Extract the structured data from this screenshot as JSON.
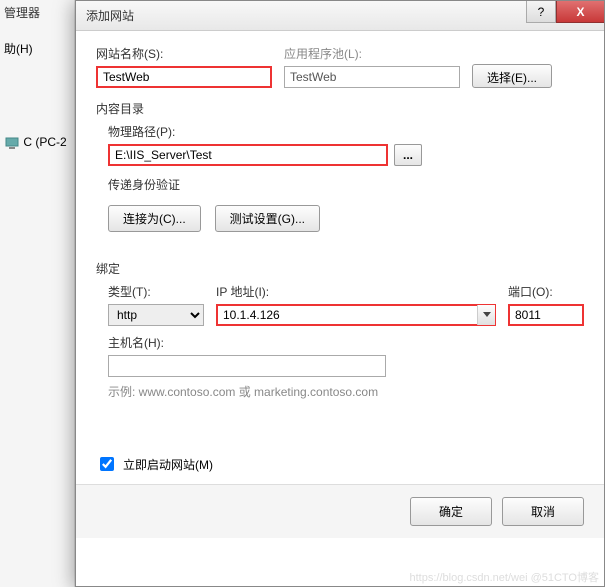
{
  "bg": {
    "manager_suffix": "管理器",
    "help_menu": "助(H)",
    "tree_node": "C (PC-2"
  },
  "titlebar": {
    "title": "添加网站",
    "help_glyph": "?",
    "close_glyph": "X"
  },
  "fields": {
    "site_name_label": "网站名称(S):",
    "site_name_value": "TestWeb",
    "app_pool_label": "应用程序池(L):",
    "app_pool_value": "TestWeb",
    "select_button": "选择(E)...",
    "content_dir_label": "内容目录",
    "phys_path_label": "物理路径(P):",
    "phys_path_value": "E:\\IIS_Server\\Test",
    "browse_glyph": "...",
    "pass_auth_label": "传递身份验证",
    "connect_as_button": "连接为(C)...",
    "test_settings_button": "测试设置(G)...",
    "binding_label": "绑定",
    "type_label": "类型(T):",
    "type_value": "http",
    "ip_label": "IP 地址(I):",
    "ip_value": "10.1.4.126",
    "port_label": "端口(O):",
    "port_value": "8011",
    "hostname_label": "主机名(H):",
    "hostname_value": "",
    "example_text": "示例: www.contoso.com 或 marketing.contoso.com",
    "start_immediately_label": "立即启动网站(M)"
  },
  "footer": {
    "ok": "确定",
    "cancel": "取消"
  },
  "watermark": "https://blog.csdn.net/wei @51CTO博客"
}
